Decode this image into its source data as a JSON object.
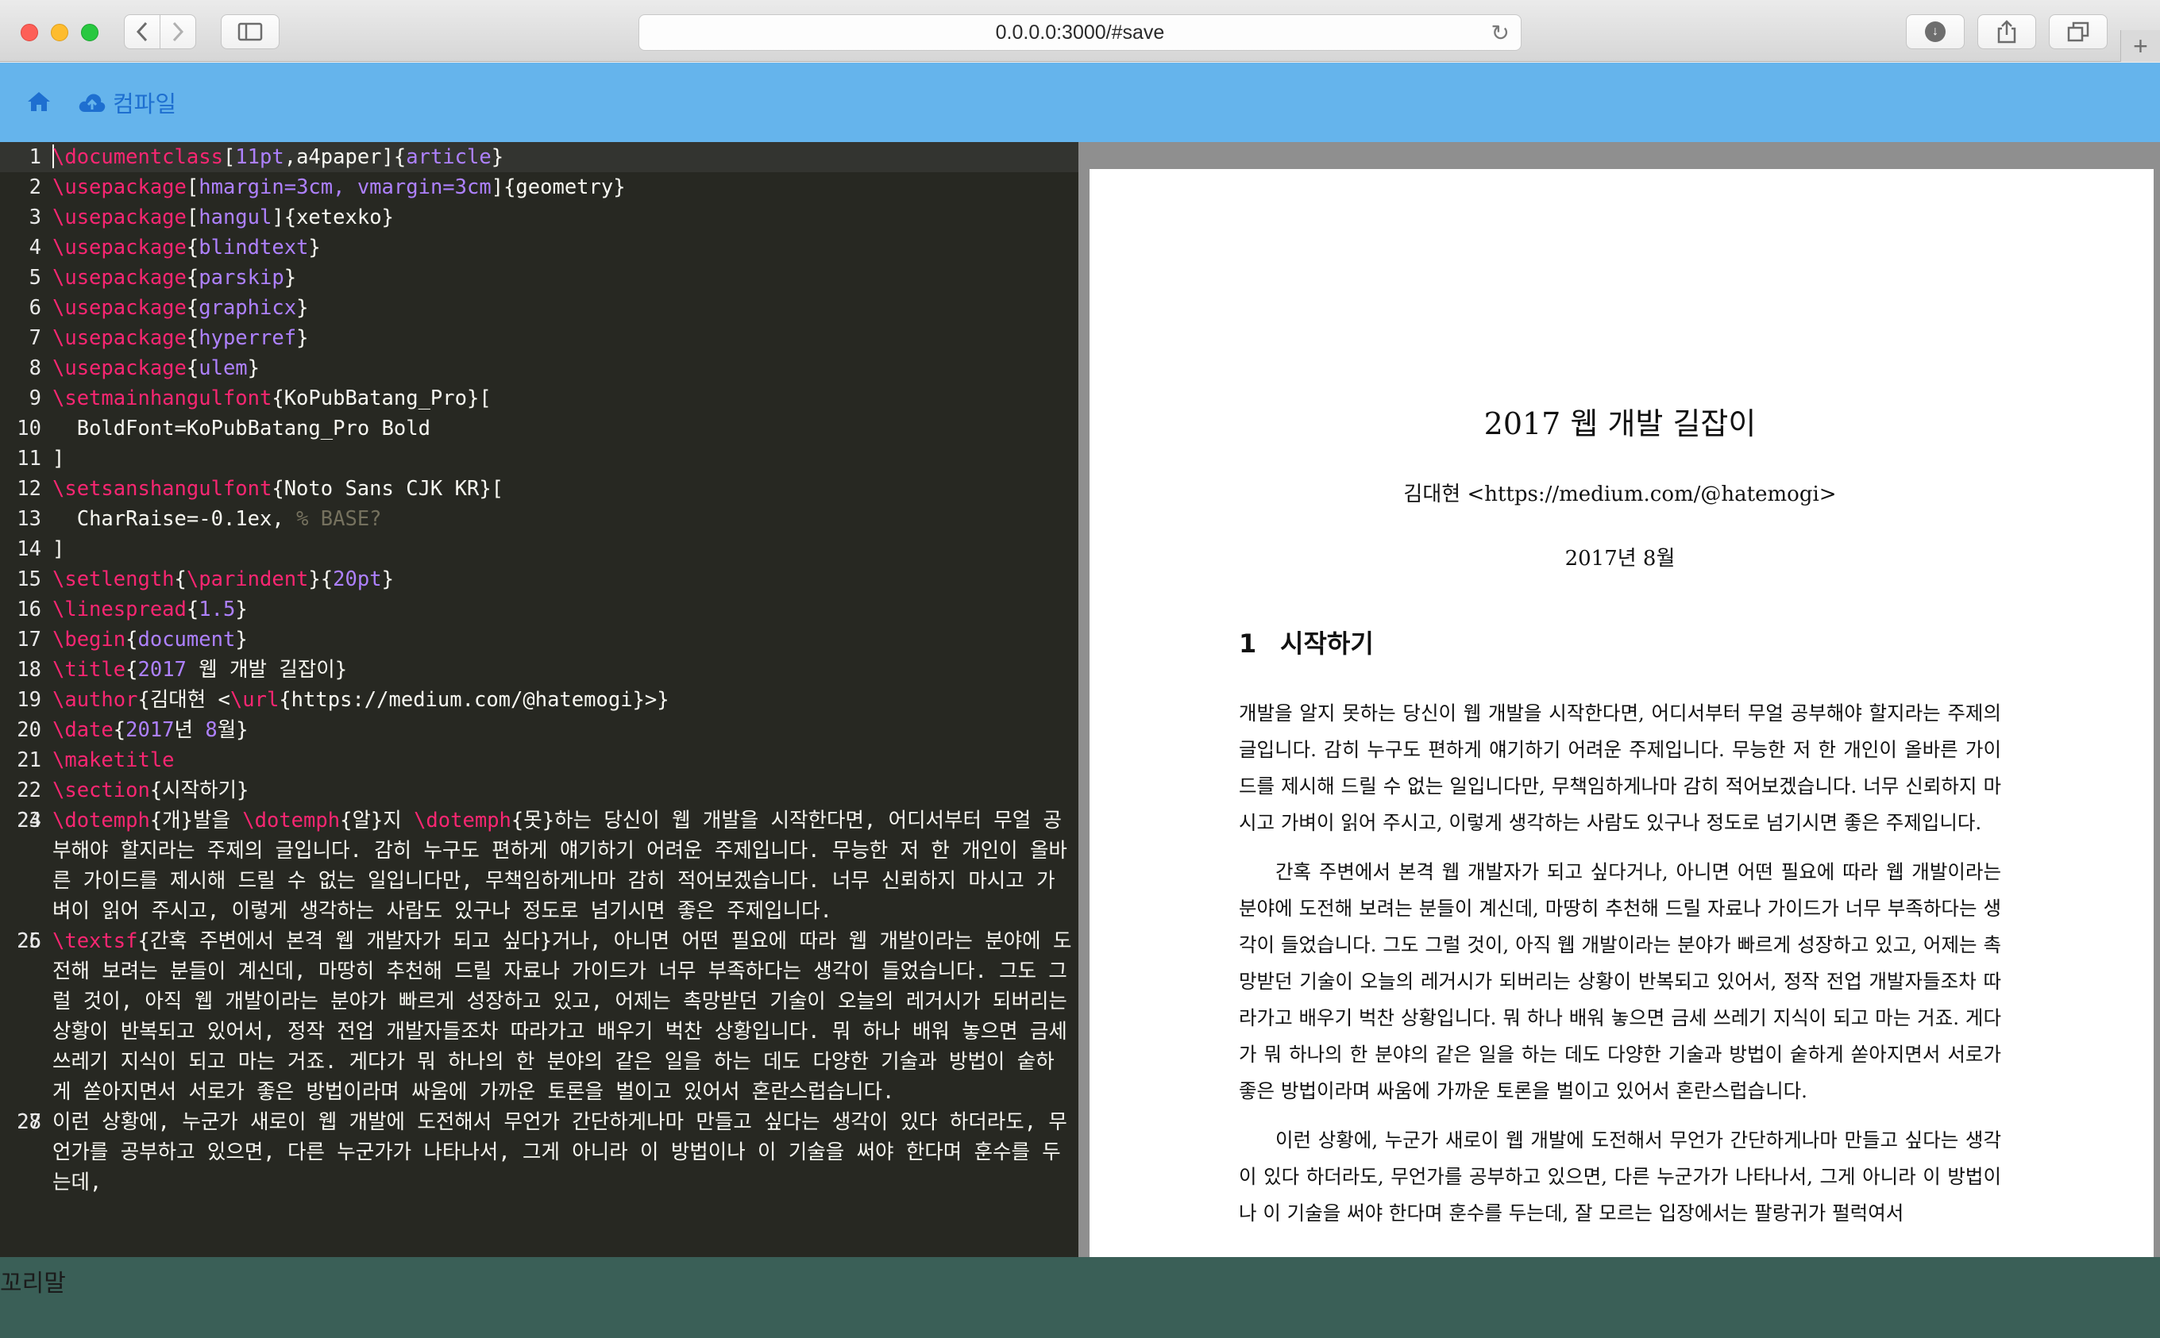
{
  "browser": {
    "url": "0.0.0.0:3000/#save",
    "back_icon": "chevron-left",
    "forward_icon": "chevron-right",
    "sidebar_icon": "sidebar",
    "reload_icon": "reload",
    "download_icon": "download",
    "share_icon": "share",
    "tabs_icon": "tabs",
    "new_tab_label": "+"
  },
  "toolbar": {
    "home_icon": "home",
    "compile_label": "컴파일",
    "compile_icon": "cloud-upload"
  },
  "editor": {
    "lines": [
      {
        "n": "1",
        "segs": [
          {
            "c": "kw",
            "t": "\\documentclass"
          },
          {
            "t": "["
          },
          {
            "c": "arg",
            "t": "11pt"
          },
          {
            "t": ",a4paper]{"
          },
          {
            "c": "arg",
            "t": "article"
          },
          {
            "t": "}"
          }
        ]
      },
      {
        "n": "2",
        "segs": [
          {
            "c": "kw",
            "t": "\\usepackage"
          },
          {
            "t": "["
          },
          {
            "c": "arg",
            "t": "hmargin=3cm, vmargin=3cm"
          },
          {
            "t": "]{geometry}"
          }
        ]
      },
      {
        "n": "3",
        "segs": [
          {
            "c": "kw",
            "t": "\\usepackage"
          },
          {
            "t": "["
          },
          {
            "c": "arg",
            "t": "hangul"
          },
          {
            "t": "]{xetexko}"
          }
        ]
      },
      {
        "n": "4",
        "segs": [
          {
            "c": "kw",
            "t": "\\usepackage"
          },
          {
            "t": "{"
          },
          {
            "c": "arg",
            "t": "blindtext"
          },
          {
            "t": "}"
          }
        ]
      },
      {
        "n": "5",
        "segs": [
          {
            "c": "kw",
            "t": "\\usepackage"
          },
          {
            "t": "{"
          },
          {
            "c": "arg",
            "t": "parskip"
          },
          {
            "t": "}"
          }
        ]
      },
      {
        "n": "6",
        "segs": [
          {
            "c": "kw",
            "t": "\\usepackage"
          },
          {
            "t": "{"
          },
          {
            "c": "arg",
            "t": "graphicx"
          },
          {
            "t": "}"
          }
        ]
      },
      {
        "n": "7",
        "segs": [
          {
            "c": "kw",
            "t": "\\usepackage"
          },
          {
            "t": "{"
          },
          {
            "c": "arg",
            "t": "hyperref"
          },
          {
            "t": "}"
          }
        ]
      },
      {
        "n": "8",
        "segs": [
          {
            "c": "kw",
            "t": "\\usepackage"
          },
          {
            "t": "{"
          },
          {
            "c": "arg",
            "t": "ulem"
          },
          {
            "t": "}"
          }
        ]
      },
      {
        "n": "9",
        "segs": [
          {
            "c": "kw",
            "t": "\\setmainhangulfont"
          },
          {
            "t": "{KoPubBatang_Pro}["
          }
        ]
      },
      {
        "n": "10",
        "segs": [
          {
            "t": "  BoldFont=KoPubBatang_Pro Bold"
          }
        ]
      },
      {
        "n": "11",
        "segs": [
          {
            "t": "]"
          }
        ]
      },
      {
        "n": "12",
        "segs": [
          {
            "c": "kw",
            "t": "\\setsanshangulfont"
          },
          {
            "t": "{Noto Sans CJK KR}["
          }
        ]
      },
      {
        "n": "13",
        "segs": [
          {
            "t": "  CharRaise=-0.1ex, "
          },
          {
            "c": "cm",
            "t": "% BASE?"
          }
        ]
      },
      {
        "n": "14",
        "segs": [
          {
            "t": "]"
          }
        ]
      },
      {
        "n": "15",
        "segs": [
          {
            "c": "kw",
            "t": "\\setlength"
          },
          {
            "t": "{"
          },
          {
            "c": "kw",
            "t": "\\parindent"
          },
          {
            "t": "}{"
          },
          {
            "c": "arg",
            "t": "20pt"
          },
          {
            "t": "}"
          }
        ]
      },
      {
        "n": "16",
        "segs": [
          {
            "c": "kw",
            "t": "\\linespread"
          },
          {
            "t": "{"
          },
          {
            "c": "arg",
            "t": "1.5"
          },
          {
            "t": "}"
          }
        ]
      },
      {
        "n": "17",
        "segs": [
          {
            "c": "kw",
            "t": "\\begin"
          },
          {
            "t": "{"
          },
          {
            "c": "arg",
            "t": "document"
          },
          {
            "t": "}"
          }
        ]
      },
      {
        "n": "18",
        "segs": [
          {
            "c": "kw",
            "t": "\\title"
          },
          {
            "t": "{"
          },
          {
            "c": "arg",
            "t": "2017"
          },
          {
            "t": " 웹 개발 길잡이}"
          }
        ]
      },
      {
        "n": "19",
        "segs": [
          {
            "c": "kw",
            "t": "\\author"
          },
          {
            "t": "{김대현 <"
          },
          {
            "c": "kw",
            "t": "\\url"
          },
          {
            "t": "{https://medium.com/@hatemogi}>}"
          }
        ]
      },
      {
        "n": "20",
        "segs": [
          {
            "c": "kw",
            "t": "\\date"
          },
          {
            "t": "{"
          },
          {
            "c": "arg",
            "t": "2017"
          },
          {
            "t": "년 "
          },
          {
            "c": "arg",
            "t": "8"
          },
          {
            "t": "월}"
          }
        ]
      },
      {
        "n": "21",
        "segs": [
          {
            "c": "kw",
            "t": "\\maketitle"
          }
        ]
      },
      {
        "n": "22",
        "segs": [
          {
            "c": "kw",
            "t": "\\section"
          },
          {
            "t": "{시작하기}"
          }
        ]
      },
      {
        "n": "23",
        "segs": [
          {
            "t": ""
          }
        ]
      },
      {
        "n": "24",
        "segs": [
          {
            "c": "kw",
            "t": "\\dotemph"
          },
          {
            "t": "{개}발을 "
          },
          {
            "c": "kw",
            "t": "\\dotemph"
          },
          {
            "t": "{알}지 "
          },
          {
            "c": "kw",
            "t": "\\dotemph"
          },
          {
            "t": "{못}하는 당신이 웹 개발을 시작한다면, 어디서부터 무얼 공부해야 할지라는 주제의 글입니다. 감히 누구도 편하게 얘기하기 어려운 주제입니다. 무능한 저 한 개인이 올바른 가이드를 제시해 드릴 수 없는 일입니다만, 무책임하게나마 감히 적어보겠습니다. 너무 신뢰하지 마시고 가벼이 읽어 주시고, 이렇게 생각하는 사람도 있구나 정도로 넘기시면 좋은 주제입니다."
          }
        ]
      },
      {
        "n": "25",
        "segs": [
          {
            "t": ""
          }
        ]
      },
      {
        "n": "26",
        "segs": [
          {
            "c": "kw",
            "t": "\\textsf"
          },
          {
            "t": "{간혹 주변에서 본격 웹 개발자가 되고 싶다}거나, 아니면 어떤 필요에 따라 웹 개발이라는 분야에 도전해 보려는 분들이 계신데, 마땅히 추천해 드릴 자료나 가이드가 너무 부족하다는 생각이 들었습니다. 그도 그럴 것이, 아직 웹 개발이라는 분야가 빠르게 성장하고 있고, 어제는 촉망받던 기술이 오늘의 레거시가 되버리는 상황이 반복되고 있어서, 정작 전업 개발자들조차 따라가고 배우기 벅찬 상황입니다. 뭐 하나 배워 놓으면 금세 쓰레기 지식이 되고 마는 거죠. 게다가 뭐 하나의 한 분야의 같은 일을 하는 데도 다양한 기술과 방법이 숱하게 쏟아지면서 서로가 좋은 방법이라며 싸움에 가까운 토론을 벌이고 있어서 혼란스럽습니다."
          }
        ]
      },
      {
        "n": "27",
        "segs": [
          {
            "t": ""
          }
        ]
      },
      {
        "n": "28",
        "segs": [
          {
            "t": "이런 상황에, 누군가 새로이 웹 개발에 도전해서 무언가 간단하게나마 만들고 싶다는 생각이 있다 하더라도, 무언가를 공부하고 있으면, 다른 누군가가 나타나서, 그게 아니라 이 방법이나 이 기술을 써야 한다며 훈수를 두는데,"
          }
        ]
      }
    ]
  },
  "preview": {
    "title": "2017 웹 개발 길잡이",
    "author": "김대현 <https://medium.com/@hatemogi>",
    "date": "2017년 8월",
    "section_number": "1",
    "section_title": "시작하기",
    "paragraphs": [
      "개발을 알지 못하는 당신이 웹 개발을 시작한다면, 어디서부터 무얼 공부해야 할지라는 주제의 글입니다. 감히 누구도 편하게 얘기하기 어려운 주제입니다. 무능한 저 한 개인이 올바른 가이드를 제시해 드릴 수 없는 일입니다만, 무책임하게나마 감히 적어보겠습니다. 너무 신뢰하지 마시고 가벼이 읽어 주시고, 이렇게 생각하는 사람도 있구나 정도로 넘기시면 좋은 주제입니다.",
      "간혹 주변에서 본격 웹 개발자가 되고 싶다거나, 아니면 어떤 필요에 따라 웹 개발이라는 분야에 도전해 보려는 분들이 계신데, 마땅히 추천해 드릴 자료나 가이드가 너무 부족하다는 생각이 들었습니다. 그도 그럴 것이, 아직 웹 개발이라는 분야가 빠르게 성장하고 있고, 어제는 촉망받던 기술이 오늘의 레거시가 되버리는 상황이 반복되고 있어서, 정작 전업 개발자들조차 따라가고 배우기 벅찬 상황입니다. 뭐 하나 배워 놓으면 금세 쓰레기 지식이 되고 마는 거죠. 게다가 뭐 하나의 한 분야의 같은 일을 하는 데도 다양한 기술과 방법이 숱하게 쏟아지면서 서로가 좋은 방법이라며 싸움에 가까운 토론을 벌이고 있어서 혼란스럽습니다.",
      "이런 상황에, 누군가 새로이 웹 개발에 도전해서 무언가 간단하게나마 만들고 싶다는 생각이 있다 하더라도, 무언가를 공부하고 있으면, 다른 누군가가 나타나서, 그게 아니라 이 방법이나 이 기술을 써야 한다며 훈수를 두는데, 잘 모르는 입장에서는 팔랑귀가 펄럭여서"
    ]
  },
  "footer": {
    "text": "꼬리말"
  },
  "colors": {
    "appbar": "#65b4ec",
    "editor_bg": "#272822",
    "keyword": "#f92672",
    "argument": "#ae81ff",
    "comment": "#75715e",
    "footer_bg": "#3a5f57"
  }
}
